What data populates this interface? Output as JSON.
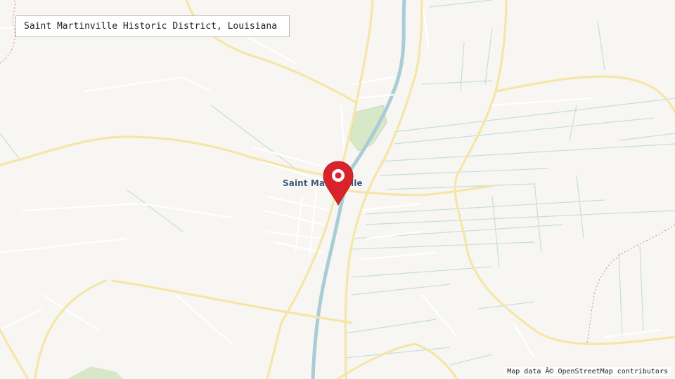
{
  "map": {
    "title": "Saint Martinville Historic District, Louisiana",
    "place_label": "Saint Martinville",
    "attribution": "Map data Â© OpenStreetMap contributors",
    "marker_icon": "map-pin-icon",
    "colors": {
      "land": "#f8f6f2",
      "road_major": "#f5e6a8",
      "road_minor": "#ffffff",
      "waterway": "#a9cdd6",
      "ditch": "#c5dde2",
      "park": "#d7e8c8",
      "boundary": "#d08a8a",
      "marker": "#d8232a"
    }
  }
}
